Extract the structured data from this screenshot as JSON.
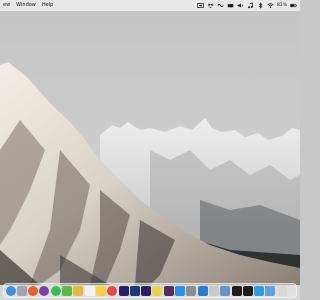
{
  "menubar": {
    "items": [
      "ew",
      "Window",
      "Help"
    ],
    "status": {
      "battery_percent": "81%"
    },
    "icons": [
      "screen-capture-icon",
      "dropbox-icon",
      "wave-icon",
      "keyboard-icon",
      "sound-icon",
      "music-note-icon",
      "bluetooth-icon",
      "wifi-icon",
      "battery-icon"
    ]
  },
  "dock": {
    "apps": [
      {
        "name": "finder",
        "color": "#3d8fe0"
      },
      {
        "name": "launchpad",
        "color": "#9aa4b3"
      },
      {
        "name": "firefox",
        "color": "#e8632b"
      },
      {
        "name": "tor-browser",
        "color": "#7d3fa5"
      },
      {
        "name": "messages",
        "color": "#39c04a"
      },
      {
        "name": "maps",
        "color": "#5fb84d"
      },
      {
        "name": "photos",
        "color": "#e7b63c"
      },
      {
        "name": "calendar",
        "color": "#f2f2f2"
      },
      {
        "name": "notes",
        "color": "#f7d247"
      },
      {
        "name": "chrome",
        "color": "#e54a3a"
      },
      {
        "name": "premiere-pro",
        "color": "#2d1f66"
      },
      {
        "name": "photoshop",
        "color": "#1b3a73"
      },
      {
        "name": "after-effects",
        "color": "#2a1f5e"
      },
      {
        "name": "notepad",
        "color": "#e8d54f"
      },
      {
        "name": "slack",
        "color": "#5a2a63"
      },
      {
        "name": "app-store",
        "color": "#2b8de8"
      },
      {
        "name": "system-preferences",
        "color": "#8c8c8c"
      },
      {
        "name": "vscode",
        "color": "#2a7bd1"
      },
      {
        "name": "utility",
        "color": "#c9c9c9"
      },
      {
        "name": "xcode",
        "color": "#6a93c9"
      },
      {
        "name": "terminal",
        "color": "#1e1e1e"
      },
      {
        "name": "activity-monitor",
        "color": "#1c1c1c"
      },
      {
        "name": "docker",
        "color": "#2f9de0"
      },
      {
        "name": "downloads-folder",
        "color": "#5fa0e0"
      },
      {
        "name": "trash",
        "color": "#d8d8d8"
      }
    ]
  }
}
